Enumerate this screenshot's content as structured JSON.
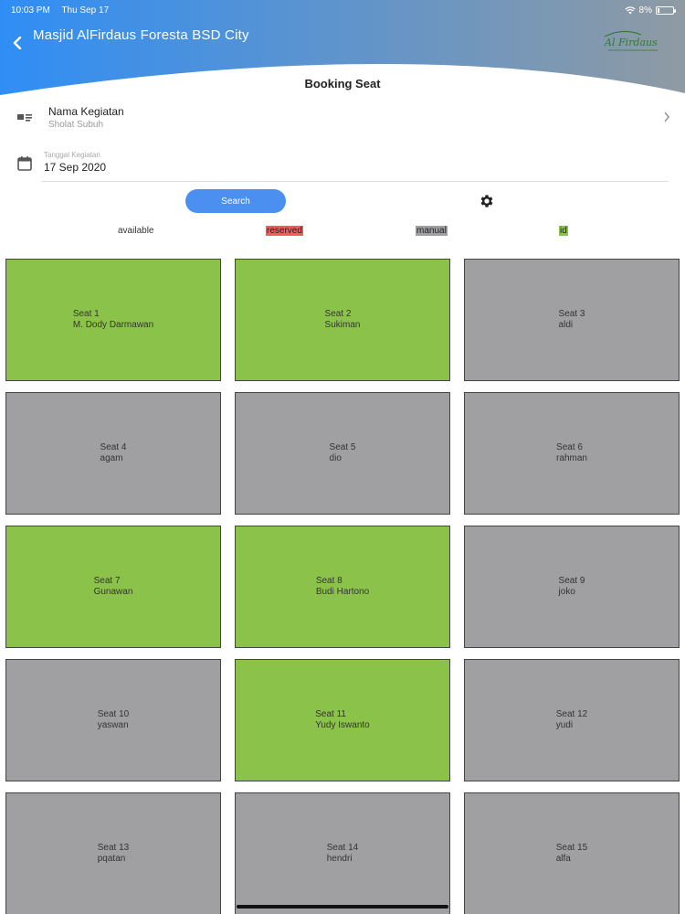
{
  "status_bar": {
    "time": "10:03 PM",
    "date": "Thu Sep 17",
    "battery": "8%"
  },
  "header": {
    "title": "Masjid AlFirdaus Foresta BSD City",
    "logo_text": "Al Firdaus"
  },
  "page_title": "Booking Seat",
  "event": {
    "label": "Nama Kegiatan",
    "value": "Sholat Subuh"
  },
  "date": {
    "label": "Tanggal Kegiatan",
    "value": "17 Sep 2020"
  },
  "search_label": "Search",
  "legend": {
    "available": "available",
    "reserved": "reserved",
    "manual": "manual",
    "id": "id"
  },
  "colors": {
    "accent": "#4b8ff0",
    "green": "#8bc34a",
    "grey": "#a0a0a3",
    "red": "#f45b5b"
  },
  "seats": [
    {
      "seat": "Seat 1",
      "name": "M. Dody Darmawan",
      "status": "id"
    },
    {
      "seat": "Seat 2",
      "name": "Sukiman",
      "status": "id"
    },
    {
      "seat": "Seat 3",
      "name": "aldi",
      "status": "manual"
    },
    {
      "seat": "Seat 4",
      "name": "agam",
      "status": "manual"
    },
    {
      "seat": "Seat 5",
      "name": "dio",
      "status": "manual"
    },
    {
      "seat": "Seat 6",
      "name": "rahman",
      "status": "manual"
    },
    {
      "seat": "Seat 7",
      "name": "Gunawan",
      "status": "id"
    },
    {
      "seat": "Seat 8",
      "name": "Budi Hartono",
      "status": "id"
    },
    {
      "seat": "Seat 9",
      "name": "joko",
      "status": "manual"
    },
    {
      "seat": "Seat 10",
      "name": "yaswan",
      "status": "manual"
    },
    {
      "seat": "Seat 11",
      "name": "Yudy Iswanto",
      "status": "id"
    },
    {
      "seat": "Seat 12",
      "name": "yudi",
      "status": "manual"
    },
    {
      "seat": "Seat 13",
      "name": "pqatan",
      "status": "manual"
    },
    {
      "seat": "Seat 14",
      "name": "hendri",
      "status": "manual"
    },
    {
      "seat": "Seat 15",
      "name": "alfa",
      "status": "manual"
    }
  ]
}
